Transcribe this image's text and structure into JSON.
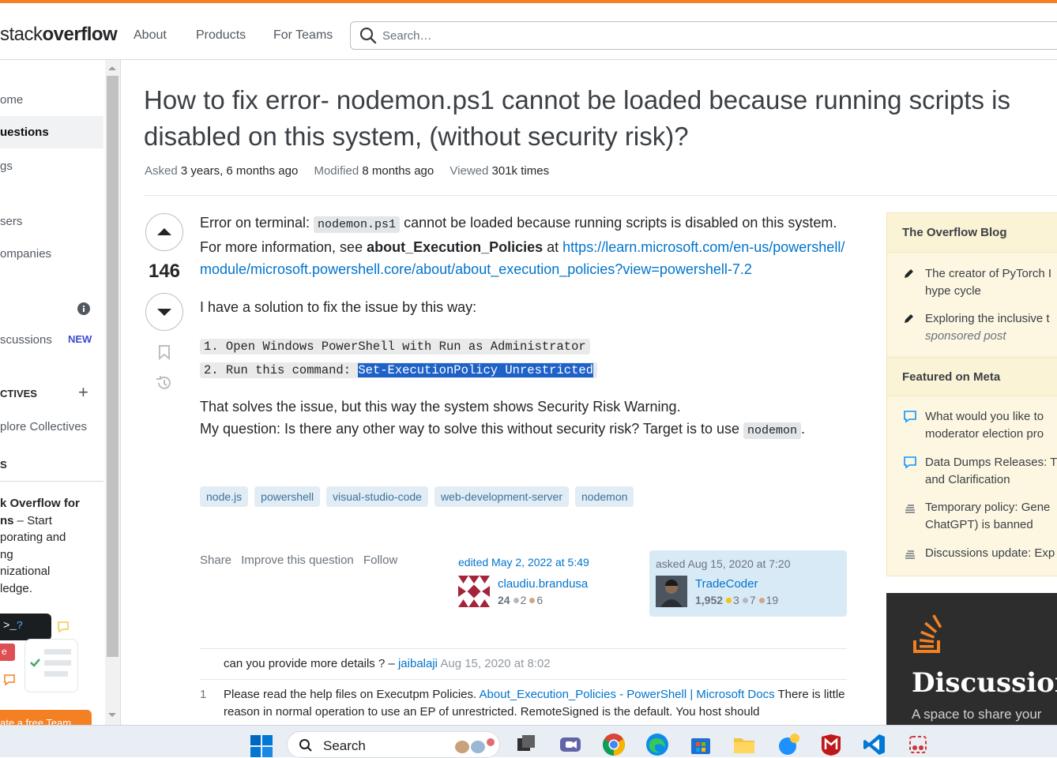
{
  "header": {
    "logo_prefix": "stack",
    "logo_bold": "overflow",
    "nav": [
      "About",
      "Products",
      "For Teams"
    ],
    "search_placeholder": "Search…"
  },
  "sidebar": {
    "items": [
      "ome",
      "uestions",
      "gs",
      "sers",
      "ompanies"
    ],
    "discussions_label": "scussions",
    "new_badge": "NEW",
    "collectives_label": "CTIVES",
    "explore_collectives": "plore Collectives",
    "teams_header": "S",
    "teams_promo_bold": "k Overflow for",
    "teams_promo_bold2": "ns",
    "teams_promo_rest": " – Start",
    "teams_promo_lines": [
      "porating and",
      "ng",
      "nizational",
      "ledge."
    ],
    "create_team_button": "ate a free Team"
  },
  "question": {
    "title": "How to fix error- nodemon.ps1 cannot be loaded because running scripts is disabled on this system, (without security risk)?",
    "asked_label": "Asked",
    "asked_value": "3 years, 6 months ago",
    "modified_label": "Modified",
    "modified_value": "8 months ago",
    "viewed_label": "Viewed",
    "viewed_value": "301k times",
    "votes": "146",
    "body": {
      "p1_prefix": "Error on terminal: ",
      "p1_code": "nodemon.ps1",
      "p1_mid": " cannot be loaded because running scripts is disabled on this system. For more information, see ",
      "p1_bold": "about_Execution_Policies",
      "p1_at": " at ",
      "p1_link": "https://learn.microsoft.com/en-us/powershell/module/microsoft.powershell.core/about/about_execution_policies?view=powershell-7.2",
      "p2": "I have a solution to fix the issue by this way:",
      "code_line1": "1. Open Windows PowerShell with Run as Administrator",
      "code_line2_prefix": "2. Run this command: ",
      "code_line2_selected": "Set-ExecutionPolicy Unrestricted",
      "p3_line1": "That solves the issue, but this way the system shows Security Risk Warning.",
      "p3_line2": "My question: Is there any other way to solve this without security risk? Target is to use ",
      "p3_code": "nodemon",
      "p3_end": "."
    },
    "tags": [
      "node.js",
      "powershell",
      "visual-studio-code",
      "web-development-server",
      "nodemon"
    ],
    "actions": [
      "Share",
      "Improve this question",
      "Follow"
    ],
    "editor": {
      "time": "edited May 2, 2022 at 5:49",
      "name": "claudiu.brandusa",
      "rep": "24",
      "silver": "2",
      "bronze": "6"
    },
    "asker": {
      "time": "asked Aug 15, 2020 at 7:20",
      "name": "TradeCoder",
      "rep": "1,952",
      "gold": "3",
      "silver": "7",
      "bronze": "19"
    }
  },
  "comments": [
    {
      "num": "",
      "text": "can you provide more details ? – ",
      "user": "jaibalaji",
      "date": "Aug 15, 2020 at 8:02"
    },
    {
      "num": "1",
      "text_before": "Please read the help files on Executpm Policies. ",
      "link": "About_Execution_Policies - PowerShell | Microsoft Docs",
      "text_after": " There is little reason in normal operation to use an EP of unrestricted. RemoteSigned is the default. You host should"
    }
  ],
  "right_sidebar": {
    "blog_header": "The Overflow Blog",
    "blog_items": [
      [
        "The creator of PyTorch I",
        "hype cycle"
      ],
      [
        "Exploring the inclusive t",
        "sponsored post"
      ]
    ],
    "meta_header": "Featured on Meta",
    "meta_items": [
      [
        "What would you like to",
        "moderator election pro"
      ],
      [
        "Data Dumps Releases: T",
        "and Clarification"
      ],
      [
        "Temporary policy: Gene",
        "ChatGPT) is banned"
      ],
      [
        "Discussions update: Exp"
      ]
    ],
    "promo_title": "Discussion",
    "promo_sub": "A space to share your"
  },
  "taskbar": {
    "search_label": "Search"
  },
  "colors": {
    "accent": "#f48024",
    "link": "#0074cc",
    "tag_bg": "#e1ecf4",
    "tag_fg": "#39739d",
    "selection": "#1e62c8"
  }
}
